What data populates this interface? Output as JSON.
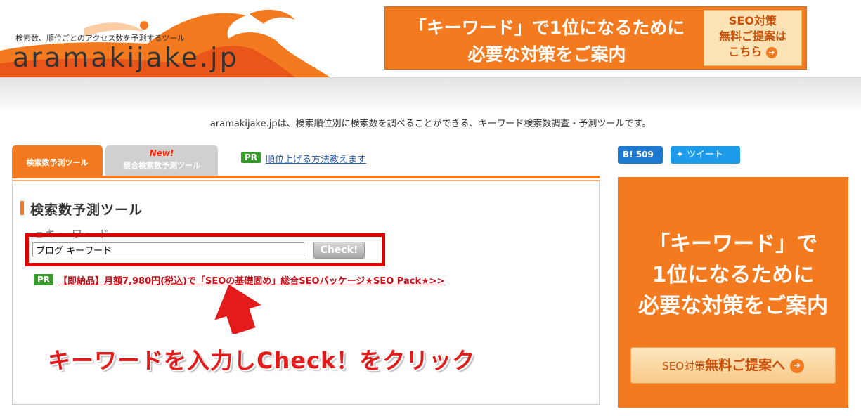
{
  "header": {
    "tagline": "検索数、順位ごとのアクセス数を予測するツール",
    "logo": "aramakijake.jp",
    "banner": {
      "line1": "「キーワード」で1位になるために",
      "line2": "必要な対策をご案内",
      "seo_lines": [
        "SEO対策",
        "無料ご提案は",
        "こちら"
      ]
    }
  },
  "intro": "aramakijake.jpは、検索順位別に検索数を調べることができる、キーワード検索数調査・予測ツールです。",
  "tabs": {
    "active": "検索数予測ツール",
    "inactive_new": "New!",
    "inactive": "競合検索数予測ツール"
  },
  "pr_top": {
    "badge": "PR",
    "link": "順位上げる方法教えます"
  },
  "tool": {
    "title": "検索数予測ツール",
    "keyword_label": "キーワード",
    "keyword_value": "ブログ キーワード",
    "check_label": "Check!"
  },
  "pr_mid": {
    "badge": "PR",
    "link": "【即納品】月額7,980円(税込)で「SEOの基礎固め」総合SEOパッケージ★SEO Pack★>>"
  },
  "instruction": "キーワードを入力しCheck！をクリック",
  "social": {
    "hatena_label": "B!",
    "hatena_count": "509",
    "tweet": "ツイート"
  },
  "side_banner": {
    "line1": "「キーワード」で",
    "line2": "1位になるために",
    "line3": "必要な対策をご案内",
    "cta_prefix": "SEO対策",
    "cta": "無料ご提案へ"
  },
  "colors": {
    "brand_orange": "#f47a1f",
    "highlight_red": "#e10000",
    "pr_green": "#3a9a2e"
  }
}
